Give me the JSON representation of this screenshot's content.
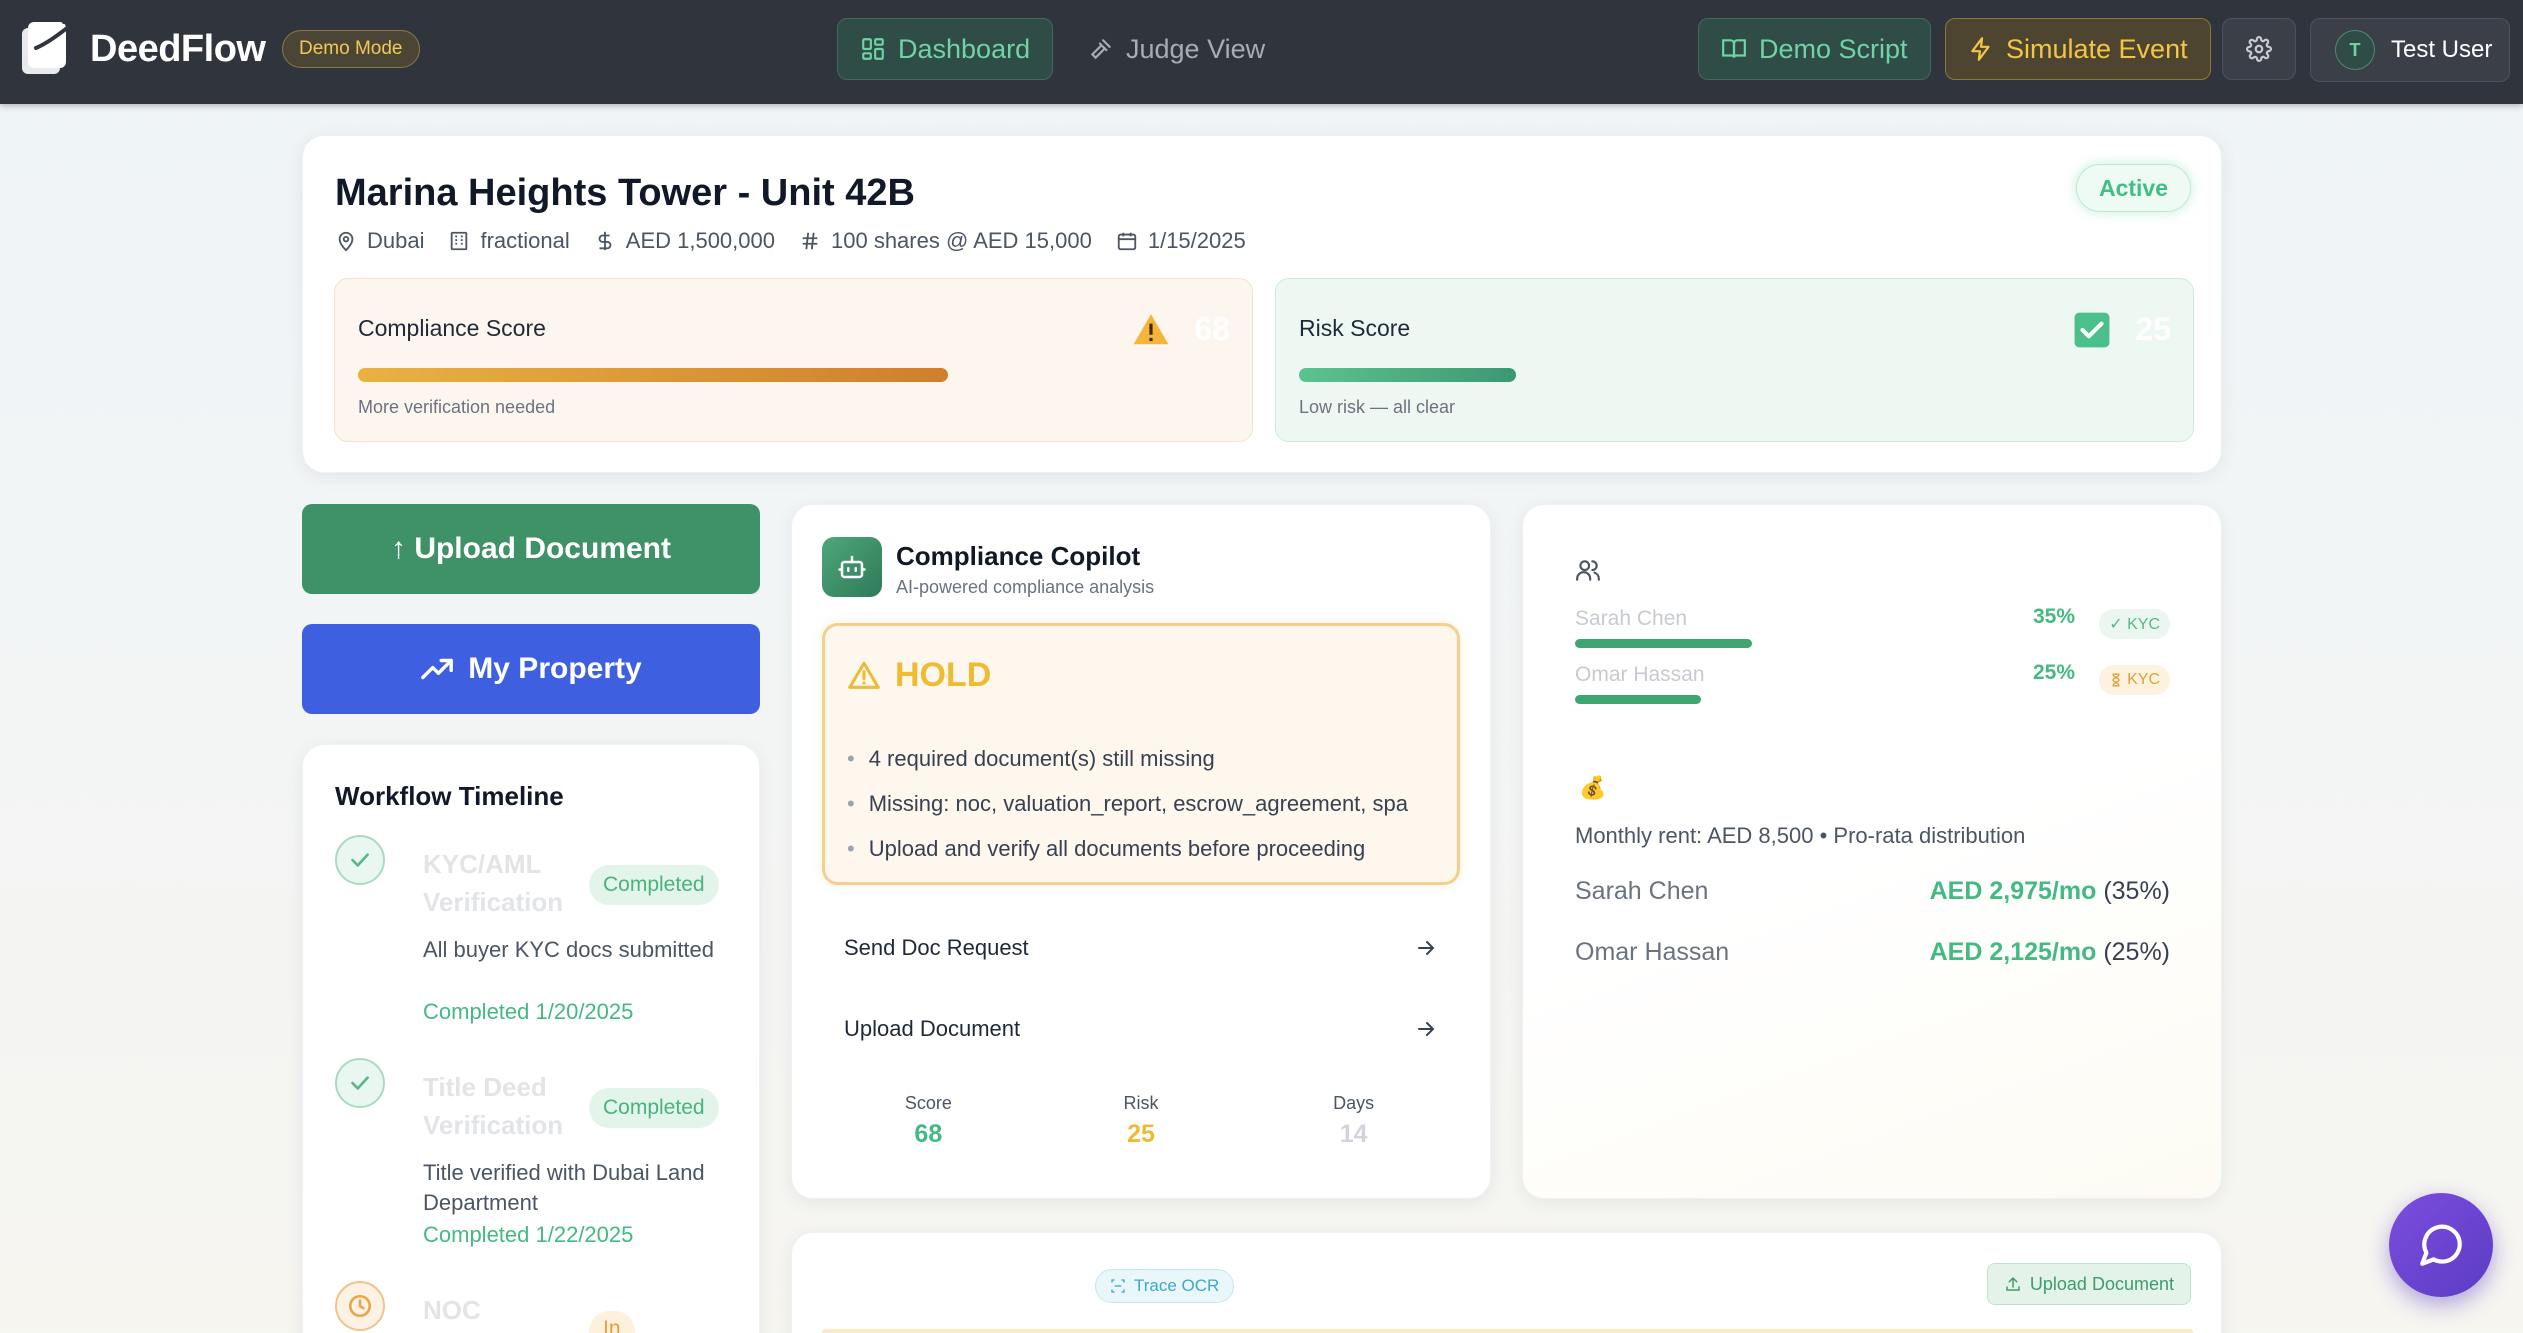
{
  "app": {
    "name": "DeedFlow",
    "mode_badge": "Demo Mode"
  },
  "nav": {
    "dashboard": "Dashboard",
    "judge_view": "Judge View",
    "demo_script": "Demo Script",
    "simulate_event": "Simulate Event",
    "user_initial": "T",
    "user_name": "Test User"
  },
  "property": {
    "title": "Marina Heights Tower - Unit 42B",
    "status": "Active",
    "location": "Dubai",
    "type": "fractional",
    "price": "AED 1,500,000",
    "shares": "100 shares @ AED 15,000",
    "date": "1/15/2025"
  },
  "scores": {
    "compliance": {
      "label": "Compliance Score",
      "value": 68,
      "note": "More verification needed"
    },
    "risk": {
      "label": "Risk Score",
      "value": 25,
      "note": "Low risk — all clear"
    }
  },
  "actions": {
    "upload": "↑ Upload Document",
    "my_property": "My Property"
  },
  "timeline": {
    "title": "Workflow Timeline",
    "steps": [
      {
        "name": "KYC/AML Verification",
        "status": "Completed",
        "desc": "All buyer KYC docs submitted",
        "date": "Completed 1/20/2025"
      },
      {
        "name": "Title Deed Verification",
        "status": "Completed",
        "desc": "Title verified with Dubai Land Department",
        "date": "Completed 1/22/2025"
      },
      {
        "name": "NOC",
        "status": "In"
      }
    ]
  },
  "copilot": {
    "title": "Compliance Copilot",
    "subtitle": "AI-powered compliance analysis",
    "decision": "HOLD",
    "reasons": [
      "4 required document(s) still missing",
      "Missing: noc, valuation_report, escrow_agreement, spa",
      "Upload and verify all documents before proceeding"
    ],
    "action_1": "Send Doc Request",
    "action_2": "Upload Document",
    "stats": {
      "score_label": "Score",
      "score": "68",
      "risk_label": "Risk",
      "risk": "25",
      "days_label": "Days",
      "days": "14"
    }
  },
  "ownership": {
    "owners": [
      {
        "name": "Sarah Chen",
        "pct": "35%",
        "share": 0.35,
        "kyc": "✓ KYC"
      },
      {
        "name": "Omar Hassan",
        "pct": "25%",
        "share": 0.25,
        "kyc": "KYC"
      }
    ],
    "money_icon": "💰",
    "rent_line": "Monthly rent: AED 8,500 • Pro-rata distribution",
    "distributions": [
      {
        "name": "Sarah Chen",
        "amount": "AED 2,975/mo",
        "pct": "(35%)"
      },
      {
        "name": "Omar Hassan",
        "amount": "AED 2,125/mo",
        "pct": "(25%)"
      }
    ]
  },
  "documents": {
    "trace_label": "Trace OCR",
    "upload_label": "Upload Document"
  },
  "colors": {
    "accent_green": "#45b982",
    "hold_yellow": "#efbb35",
    "primary_blue": "#3d5fe0",
    "topbar": "#2f343d"
  }
}
